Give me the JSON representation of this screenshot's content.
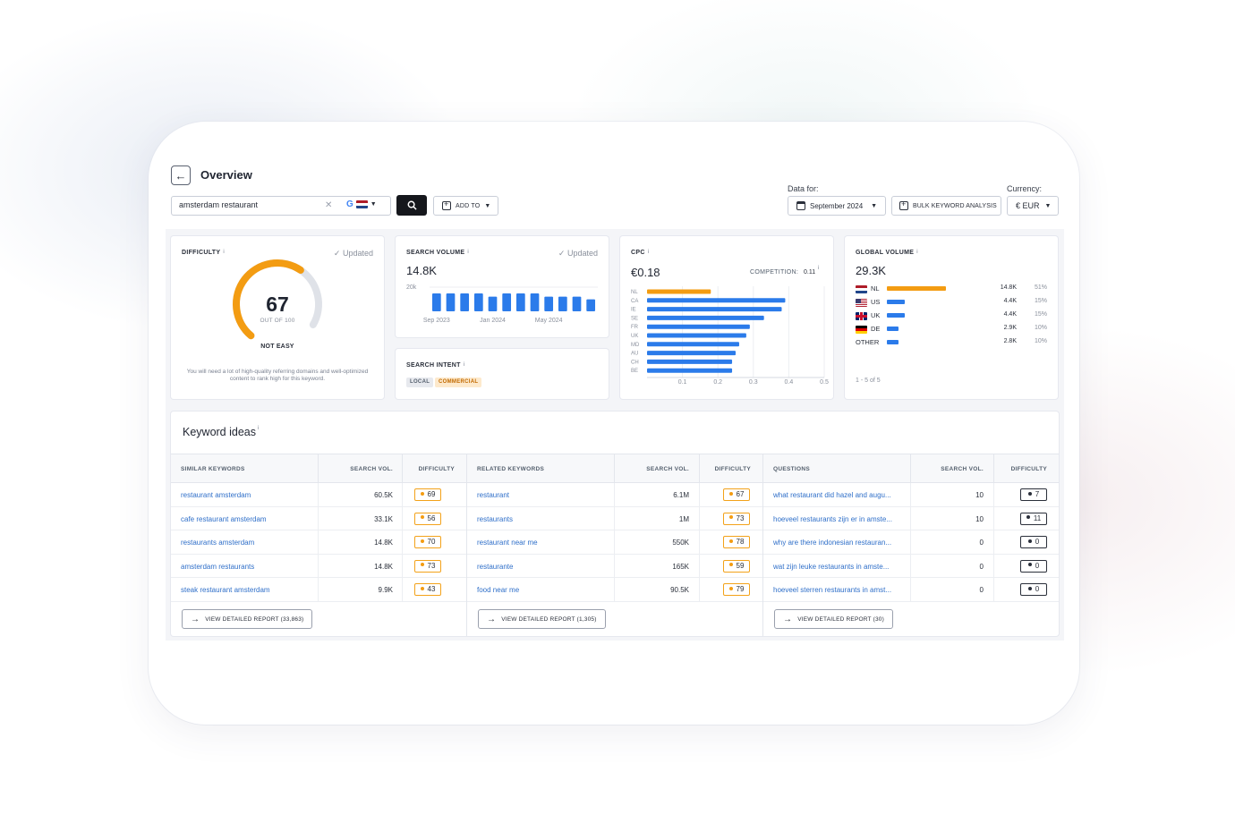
{
  "header": {
    "title": "Overview",
    "search_value": "amsterdam restaurant",
    "add_to_label": "ADD TO",
    "data_for_label": "Data for:",
    "date_value": "September 2024",
    "bulk_label": "BULK KEYWORD ANALYSIS",
    "currency_label": "Currency:",
    "currency_value": "€ EUR"
  },
  "difficulty": {
    "label": "DIFFICULTY",
    "info": "i",
    "updated": "Updated",
    "value": "67",
    "out_of": "OUT OF 100",
    "score_fraction": 0.67,
    "verdict": "NOT EASY",
    "note": "You will need a lot of high-quality referring domains and well-optimized content to rank high for this keyword.",
    "accent_color": "#f39c12"
  },
  "search_volume": {
    "label": "SEARCH VOLUME",
    "info": "i",
    "updated": "Updated",
    "value": "14.8K",
    "chart_data": {
      "type": "bar",
      "ytick": "20k",
      "ymax": 20000,
      "xticks": [
        "Sep 2023",
        "Jan 2024",
        "May 2024"
      ],
      "values": [
        14800,
        14800,
        14800,
        14800,
        12100,
        14800,
        14800,
        14800,
        12100,
        12100,
        12100,
        9900
      ],
      "color": "#2b7bea"
    }
  },
  "search_intent": {
    "label": "SEARCH INTENT",
    "info": "i",
    "tags": [
      "LOCAL",
      "COMMERCIAL"
    ]
  },
  "cpc": {
    "label": "CPC",
    "info": "i",
    "value": "€0.18",
    "competition_label": "COMPETITION:",
    "competition_value": "0.11",
    "competition_info": "i",
    "chart_data": {
      "type": "bar",
      "orientation": "horizontal",
      "categories": [
        "NL",
        "CA",
        "IE",
        "SE",
        "FR",
        "UK",
        "MD",
        "AU",
        "CH",
        "BE"
      ],
      "values": [
        0.18,
        0.39,
        0.38,
        0.33,
        0.29,
        0.28,
        0.26,
        0.25,
        0.24,
        0.24
      ],
      "highlight": "NL",
      "xticks": [
        "0.1",
        "0.2",
        "0.3",
        "0.4",
        "0.5"
      ],
      "xlim": [
        0,
        0.5
      ],
      "colors": {
        "highlight": "#f39c12",
        "default": "#2b7bea"
      }
    }
  },
  "global_volume": {
    "label": "GLOBAL VOLUME",
    "info": "i",
    "value": "29.3K",
    "rows": [
      {
        "code": "NL",
        "flag": "nl",
        "volume": "14.8K",
        "pct": "51%",
        "share": 0.51,
        "color": "#f39c12"
      },
      {
        "code": "US",
        "flag": "us",
        "volume": "4.4K",
        "pct": "15%",
        "share": 0.15,
        "color": "#2b7bea"
      },
      {
        "code": "UK",
        "flag": "uk",
        "volume": "4.4K",
        "pct": "15%",
        "share": 0.15,
        "color": "#2b7bea"
      },
      {
        "code": "DE",
        "flag": "de",
        "volume": "2.9K",
        "pct": "10%",
        "share": 0.1,
        "color": "#2b7bea"
      },
      {
        "code": "OTHER",
        "flag": "",
        "volume": "2.8K",
        "pct": "10%",
        "share": 0.1,
        "color": "#2b7bea"
      }
    ],
    "pager": "1 - 5 of 5"
  },
  "keyword_ideas": {
    "title": "Keyword ideas",
    "info": "i",
    "sections": [
      {
        "name": "similar",
        "col_keyword": "SIMILAR KEYWORDS",
        "col_volume": "SEARCH VOL.",
        "col_difficulty": "DIFFICULTY",
        "rows": [
          {
            "keyword": "restaurant amsterdam",
            "volume": "60.5K",
            "difficulty": "69"
          },
          {
            "keyword": "cafe restaurant amsterdam",
            "volume": "33.1K",
            "difficulty": "56"
          },
          {
            "keyword": "restaurants amsterdam",
            "volume": "14.8K",
            "difficulty": "70"
          },
          {
            "keyword": "amsterdam restaurants",
            "volume": "14.8K",
            "difficulty": "73"
          },
          {
            "keyword": "steak restaurant amsterdam",
            "volume": "9.9K",
            "difficulty": "43"
          }
        ],
        "report_label": "VIEW DETAILED REPORT (33,863)"
      },
      {
        "name": "related",
        "col_keyword": "RELATED KEYWORDS",
        "col_volume": "SEARCH VOL.",
        "col_difficulty": "DIFFICULTY",
        "rows": [
          {
            "keyword": "restaurant",
            "volume": "6.1M",
            "difficulty": "67"
          },
          {
            "keyword": "restaurants",
            "volume": "1M",
            "difficulty": "73"
          },
          {
            "keyword": "restaurant near me",
            "volume": "550K",
            "difficulty": "78"
          },
          {
            "keyword": "restaurante",
            "volume": "165K",
            "difficulty": "59"
          },
          {
            "keyword": "food near me",
            "volume": "90.5K",
            "difficulty": "79"
          }
        ],
        "report_label": "VIEW DETAILED REPORT (1,305)"
      },
      {
        "name": "questions",
        "col_keyword": "QUESTIONS",
        "col_volume": "SEARCH VOL.",
        "col_difficulty": "DIFFICULTY",
        "rows": [
          {
            "keyword": "what restaurant did hazel and augu...",
            "volume": "10",
            "difficulty": "7"
          },
          {
            "keyword": "hoeveel restaurants zijn er in amste...",
            "volume": "10",
            "difficulty": "11"
          },
          {
            "keyword": "why are there indonesian restauran...",
            "volume": "0",
            "difficulty": "0"
          },
          {
            "keyword": "wat zijn leuke restaurants in amste...",
            "volume": "0",
            "difficulty": "0"
          },
          {
            "keyword": "hoeveel sterren restaurants in amst...",
            "volume": "0",
            "difficulty": "0"
          }
        ],
        "report_label": "VIEW DETAILED REPORT (30)"
      }
    ]
  }
}
